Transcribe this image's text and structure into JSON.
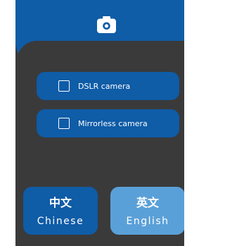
{
  "header": {
    "camera_icon": "camera-icon"
  },
  "options": [
    {
      "label": "DSLR camera",
      "checked": false
    },
    {
      "label": "Mirrorless camera",
      "checked": false
    }
  ],
  "languages": [
    {
      "native": "中文",
      "english": "Chinese",
      "selected": true
    },
    {
      "native": "英文",
      "english": "English",
      "selected": false
    }
  ],
  "colors": {
    "primary": "#0f5ca7",
    "secondary": "#5aa0d8",
    "background": "#3a3a3a",
    "text": "#ffffff"
  }
}
